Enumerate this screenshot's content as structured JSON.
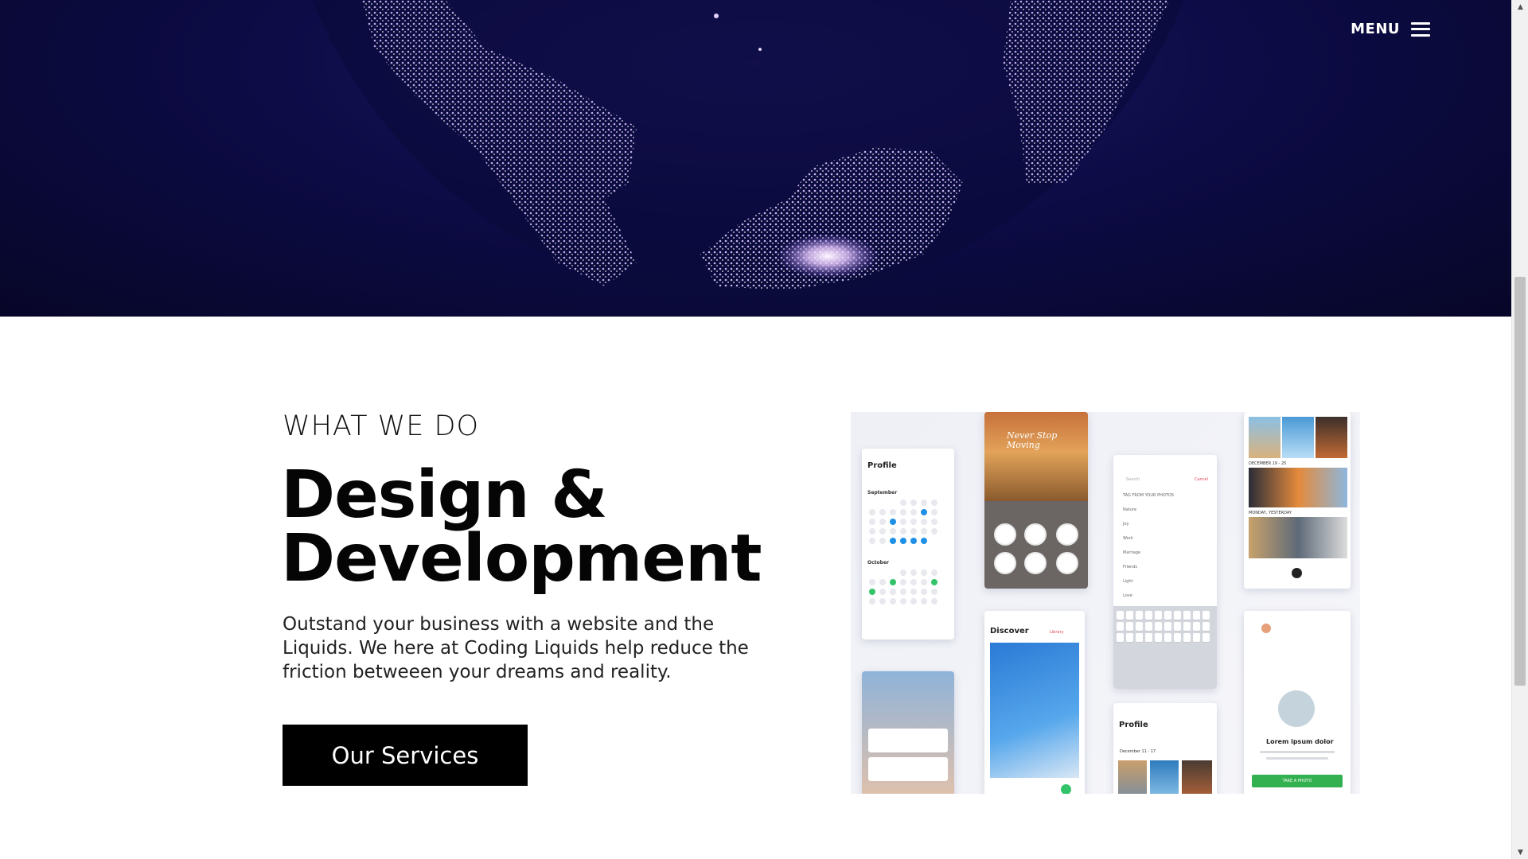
{
  "nav": {
    "menu_label": "MENU",
    "menu_icon": "hamburger-icon"
  },
  "section": {
    "eyebrow": "WHAT WE DO",
    "headline_line1": "Design &",
    "headline_line2": "Development",
    "body": "Outstand your business with a website and the Liquids. We here at Coding Liquids help reduce the friction betweeen your dreams and reality.",
    "cta_label": "Our Services"
  },
  "mockups": {
    "profile_title_1": "Profile",
    "calendar_month_1": "September",
    "calendar_month_2": "October",
    "discover_title": "Discover",
    "discover_link": "Library",
    "search_placeholder": "Search",
    "search_cancel": "Cancel",
    "search_section": "TAG FROM YOUR PHOTOS",
    "search_items": [
      "Nature",
      "Joy",
      "Work",
      "Marriage",
      "Friends",
      "Light",
      "Love"
    ],
    "profile_title_2": "Profile",
    "profile_date_range": "December 11 - 17",
    "card_title": "Lorem ipsum dolor",
    "card_button": "TAKE A PHOTO",
    "feed_label_1": "DECEMBER 19 - 25",
    "feed_label_2": "MONDAY, YESTERDAY",
    "lettering": "Never Stop Moving"
  },
  "colors": {
    "hero_bg": "#0c0b44",
    "cta_bg": "#000000",
    "accent_blue": "#1e90e6",
    "accent_green": "#33c46a"
  }
}
